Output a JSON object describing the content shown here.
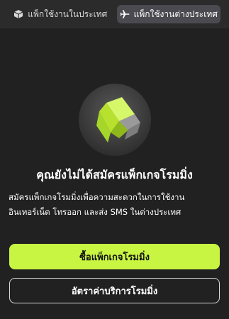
{
  "tabs": [
    {
      "label": "แพ็กใช้งานในประเทศ",
      "icon": "box-icon",
      "active": false
    },
    {
      "label": "แพ็กใช้งานต่างประเทศ",
      "icon": "airplane-icon",
      "active": true
    }
  ],
  "empty_state": {
    "title": "คุณยังไม่ได้สมัครแพ็กเกจโรมมิ่ง",
    "description": "สมัครแพ็กเกจโรมมิ่งเพื่อความสะดวกในการใช้งานอินเทอร์เน็ต โทรออก และส่ง SMS ในต่างประเทศ"
  },
  "buttons": {
    "buy_label": "ซื้อแพ็กเกจโรมมิ่ง",
    "rates_label": "อัตราค่าบริการโรมมิ่ง"
  },
  "colors": {
    "accent": "#c8f542",
    "background": "#212121",
    "tab_bar": "#2b2b2b",
    "tab_active": "#4a4a50"
  }
}
